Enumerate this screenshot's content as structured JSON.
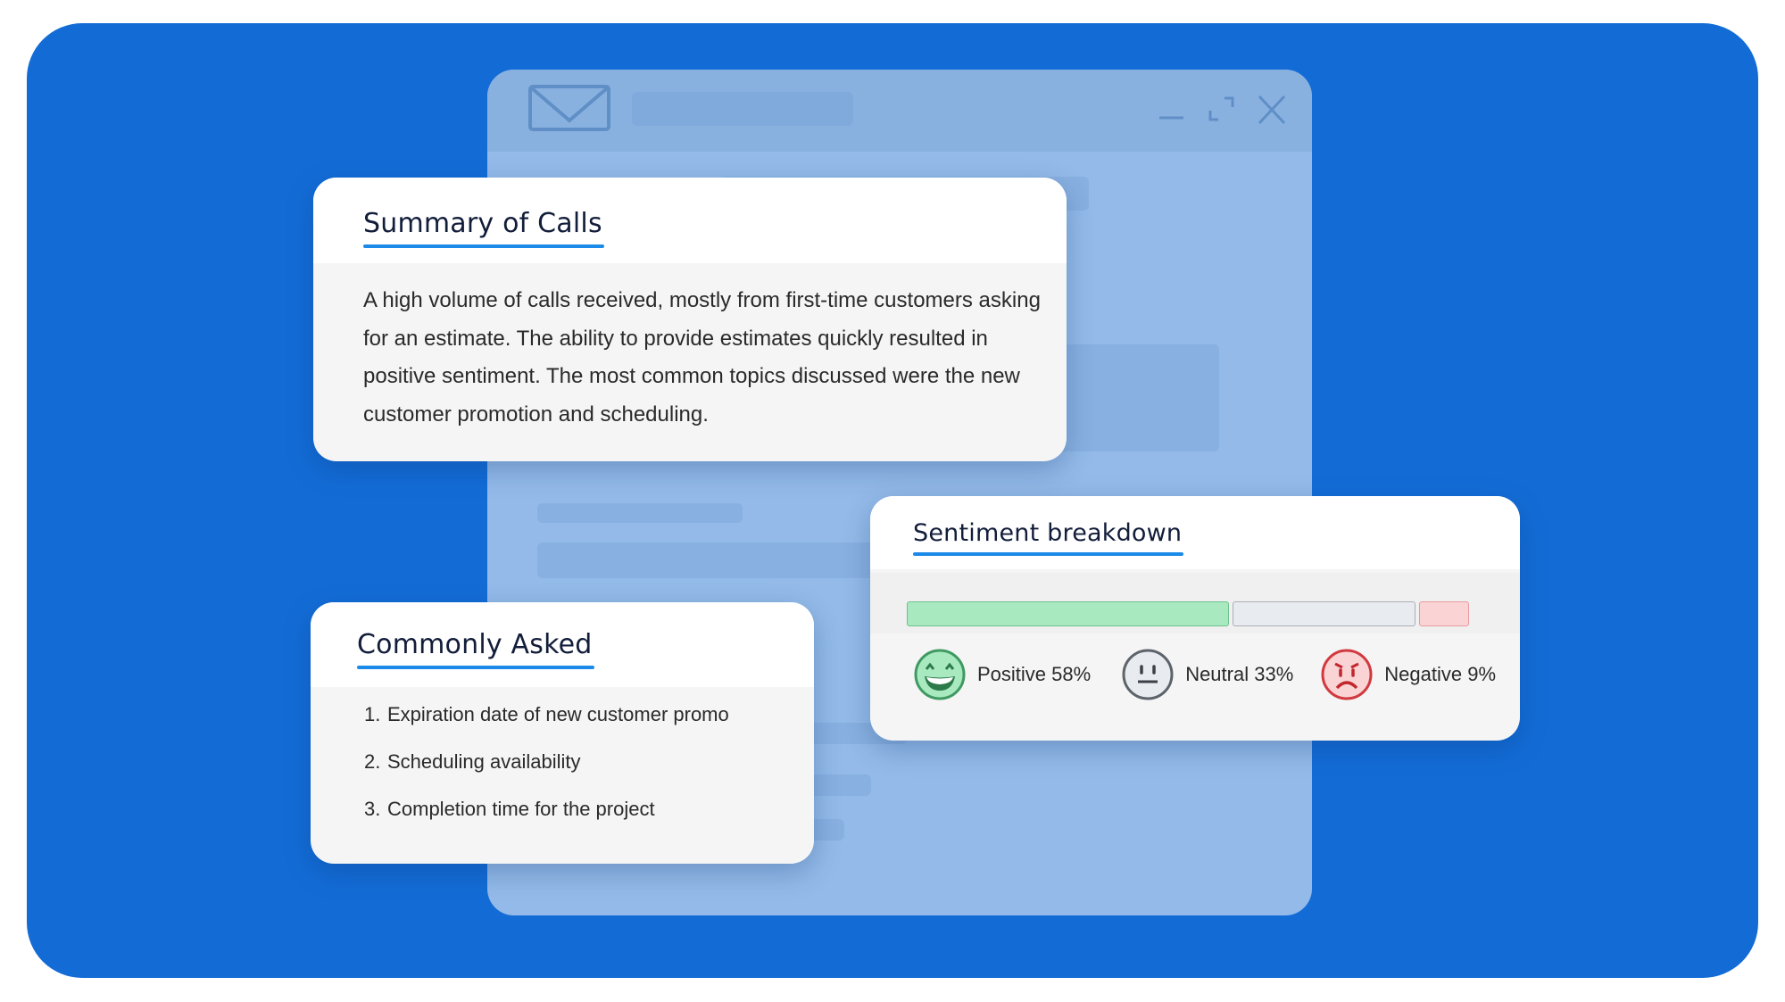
{
  "colors": {
    "background_panel": "#136cd6",
    "accent_underline": "#1c8ae8",
    "positive": "#a8e9c0",
    "neutral": "#e8ebef",
    "negative": "#fad3d5"
  },
  "window": {
    "icons": [
      "mail-icon",
      "minimize-icon",
      "maximize-icon",
      "close-icon"
    ]
  },
  "summary_card": {
    "title": "Summary of Calls",
    "body": "A high volume of calls received, mostly from first-time customers asking for an estimate. The ability to provide estimates quickly resulted in positive sentiment. The most common topics discussed were the new customer promotion and scheduling."
  },
  "asked_card": {
    "title": "Commonly Asked",
    "items": [
      {
        "num": "1.",
        "text": "Expiration date of new customer promo"
      },
      {
        "num": "2.",
        "text": "Scheduling availability"
      },
      {
        "num": "3.",
        "text": "Completion time for the project"
      }
    ]
  },
  "sentiment_card": {
    "title": "Sentiment breakdown",
    "segments": [
      {
        "name": "Positive",
        "percent": 58,
        "label": "Positive 58%",
        "icon": "smiling-face-icon"
      },
      {
        "name": "Neutral",
        "percent": 33,
        "label": "Neutral 33%",
        "icon": "neutral-face-icon"
      },
      {
        "name": "Negative",
        "percent": 9,
        "label": "Negative 9%",
        "icon": "angry-face-icon"
      }
    ]
  }
}
